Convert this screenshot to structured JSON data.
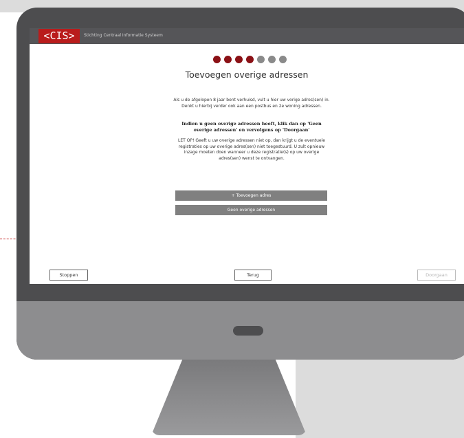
{
  "header": {
    "logo_text": "<CIS>",
    "brand_name": "Stichting Centraal Informatie Systeem"
  },
  "progress": {
    "total_steps": 7,
    "completed_steps": 4,
    "active_color": "#8b1116",
    "inactive_color": "#8a8a8a"
  },
  "main": {
    "title": "Toevoegen overige adressen",
    "intro": "Als u de afgelopen 8 jaar bent verhuisd, vult u hier uw vorige adres(sen) in. Denkt u hierbij verder ook aan een postbus en 2e woning adressen.",
    "instruction_bold": "Indien u geen overige adressen heeft, klik dan op 'Geen overige adressen' en vervolgens op 'Doorgaan'",
    "warning": "LET OP! Geeft u uw overige adressen niet op, dan krijgt u de eventuele registraties op uw overige adres(sen) niet toegestuurd. U zult opnieuw inzage moeten doen wanneer u deze registratie(s) op uw overige adres(sen) wenst te ontvangen.",
    "add_address_label": "+ Toevoegen adres",
    "no_addresses_label": "Geen overige adressen"
  },
  "footer": {
    "stop_label": "Stoppen",
    "back_label": "Terug",
    "continue_label": "Doorgaan"
  },
  "colors": {
    "brand_red": "#b91c1c",
    "monitor_frame": "#4d4d4f",
    "monitor_chin": "#8d8d8f"
  }
}
